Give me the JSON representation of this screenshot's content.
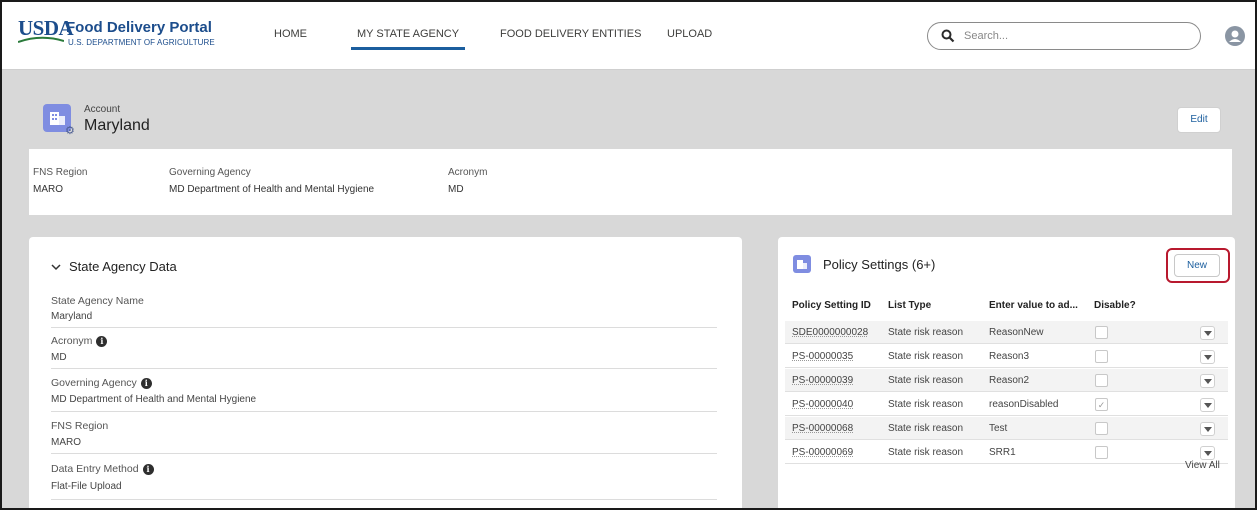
{
  "header": {
    "logo": {
      "mark": "USDA",
      "title": "Food Delivery Portal",
      "subtitle": "U.S. DEPARTMENT OF AGRICULTURE"
    },
    "nav": [
      {
        "label": "HOME",
        "active": false
      },
      {
        "label": "MY STATE AGENCY",
        "active": true
      },
      {
        "label": "FOOD DELIVERY ENTITIES",
        "active": false
      },
      {
        "label": "UPLOAD",
        "active": false
      }
    ],
    "search": {
      "placeholder": "Search...",
      "icon": "search-icon"
    },
    "avatar_icon": "user-avatar-icon"
  },
  "record": {
    "type_label": "Account",
    "name": "Maryland",
    "edit_label": "Edit",
    "highlights": [
      {
        "label": "FNS Region",
        "value": "MARO"
      },
      {
        "label": "Governing Agency",
        "value": "MD Department of Health and Mental Hygiene"
      },
      {
        "label": "Acronym",
        "value": "MD"
      }
    ]
  },
  "state_agency_section": {
    "title": "State Agency Data",
    "fields": [
      {
        "label": "State Agency Name",
        "value": "Maryland",
        "info": false
      },
      {
        "label": "Acronym",
        "value": "MD",
        "info": true
      },
      {
        "label": "Governing Agency",
        "value": "MD Department of Health and Mental Hygiene",
        "info": true
      },
      {
        "label": "FNS Region",
        "value": "MARO",
        "info": false
      },
      {
        "label": "Data Entry Method",
        "value": "Flat-File Upload",
        "info": true
      }
    ]
  },
  "policy_settings": {
    "title": "Policy Settings (6+)",
    "new_label": "New",
    "columns": [
      "Policy Setting ID",
      "List Type",
      "Enter value to ad...",
      "Disable?"
    ],
    "rows": [
      {
        "id": "SDE0000000028",
        "list_type": "State risk reason",
        "value": "ReasonNew",
        "disabled": false
      },
      {
        "id": "PS-00000035",
        "list_type": "State risk reason",
        "value": "Reason3",
        "disabled": false
      },
      {
        "id": "PS-00000039",
        "list_type": "State risk reason",
        "value": "Reason2",
        "disabled": false
      },
      {
        "id": "PS-00000040",
        "list_type": "State risk reason",
        "value": "reasonDisabled",
        "disabled": true
      },
      {
        "id": "PS-00000068",
        "list_type": "State risk reason",
        "value": "Test",
        "disabled": false
      },
      {
        "id": "PS-00000069",
        "list_type": "State risk reason",
        "value": "SRR1",
        "disabled": false
      }
    ],
    "view_all_label": "View All"
  },
  "colors": {
    "brand": "#1c4d8c",
    "nav_active": "#1b5e9e",
    "highlight_box": "#b8192e",
    "object_icon": "#7f8de1",
    "page_bg": "#d8d8d8"
  }
}
